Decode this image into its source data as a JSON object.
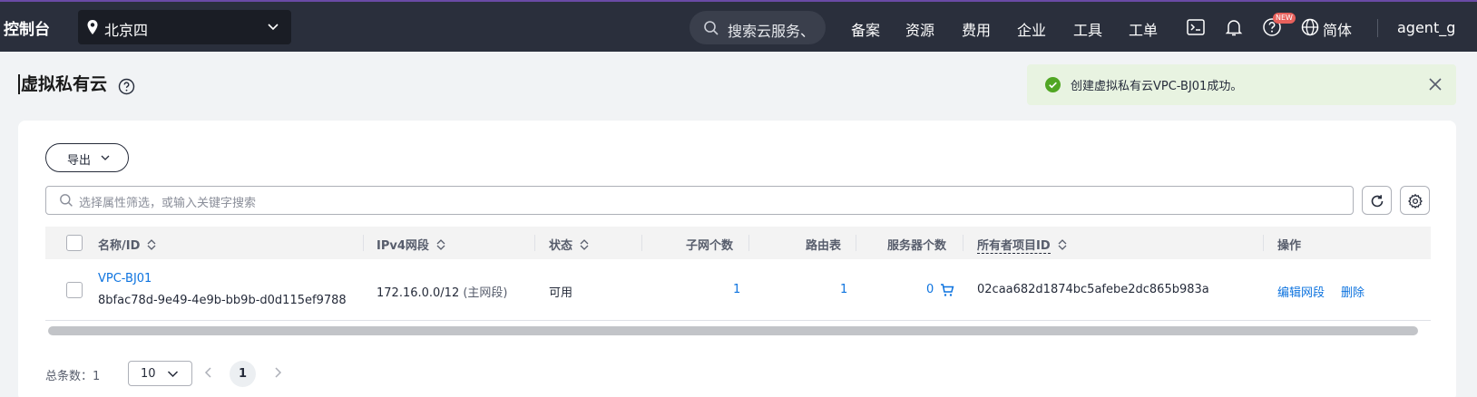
{
  "topbar": {
    "brand": "控制台",
    "region": "北京四",
    "search_placeholder": "搜索云服务、",
    "nav": [
      "备案",
      "资源",
      "费用",
      "企业",
      "工具",
      "工单"
    ],
    "new_badge": "NEW",
    "language": "简体",
    "user": "agent_g"
  },
  "page": {
    "title": "虚拟私有云"
  },
  "toast": {
    "message": "创建虚拟私有云VPC-BJ01成功。"
  },
  "toolbar": {
    "export_label": "导出",
    "filter_placeholder": "选择属性筛选，或输入关键字搜索"
  },
  "table": {
    "headers": {
      "name": "名称/ID",
      "ipv4": "IPv4网段",
      "status": "状态",
      "subnets": "子网个数",
      "route_tables": "路由表",
      "servers": "服务器个数",
      "owner_project": "所有者项目ID",
      "actions": "操作"
    },
    "rows": [
      {
        "name": "VPC-BJ01",
        "id": "8bfac78d-9e49-4e9b-bb9b-d0d115ef9788",
        "ipv4": "172.16.0.0/12",
        "ipv4_note": "(主网段)",
        "status": "可用",
        "subnets": "1",
        "route_tables": "1",
        "servers": "0",
        "owner_project": "02caa682d1874bc5afebe2dc865b983a",
        "action_edit": "编辑网段",
        "action_delete": "删除"
      }
    ]
  },
  "pagination": {
    "total_label": "总条数：1",
    "page_size": "10",
    "current_page": "1"
  },
  "colors": {
    "topbar_bg": "#2a2f3c",
    "link": "#0d73df",
    "success": "#50a623",
    "toast_bg": "#e8f3e1"
  }
}
